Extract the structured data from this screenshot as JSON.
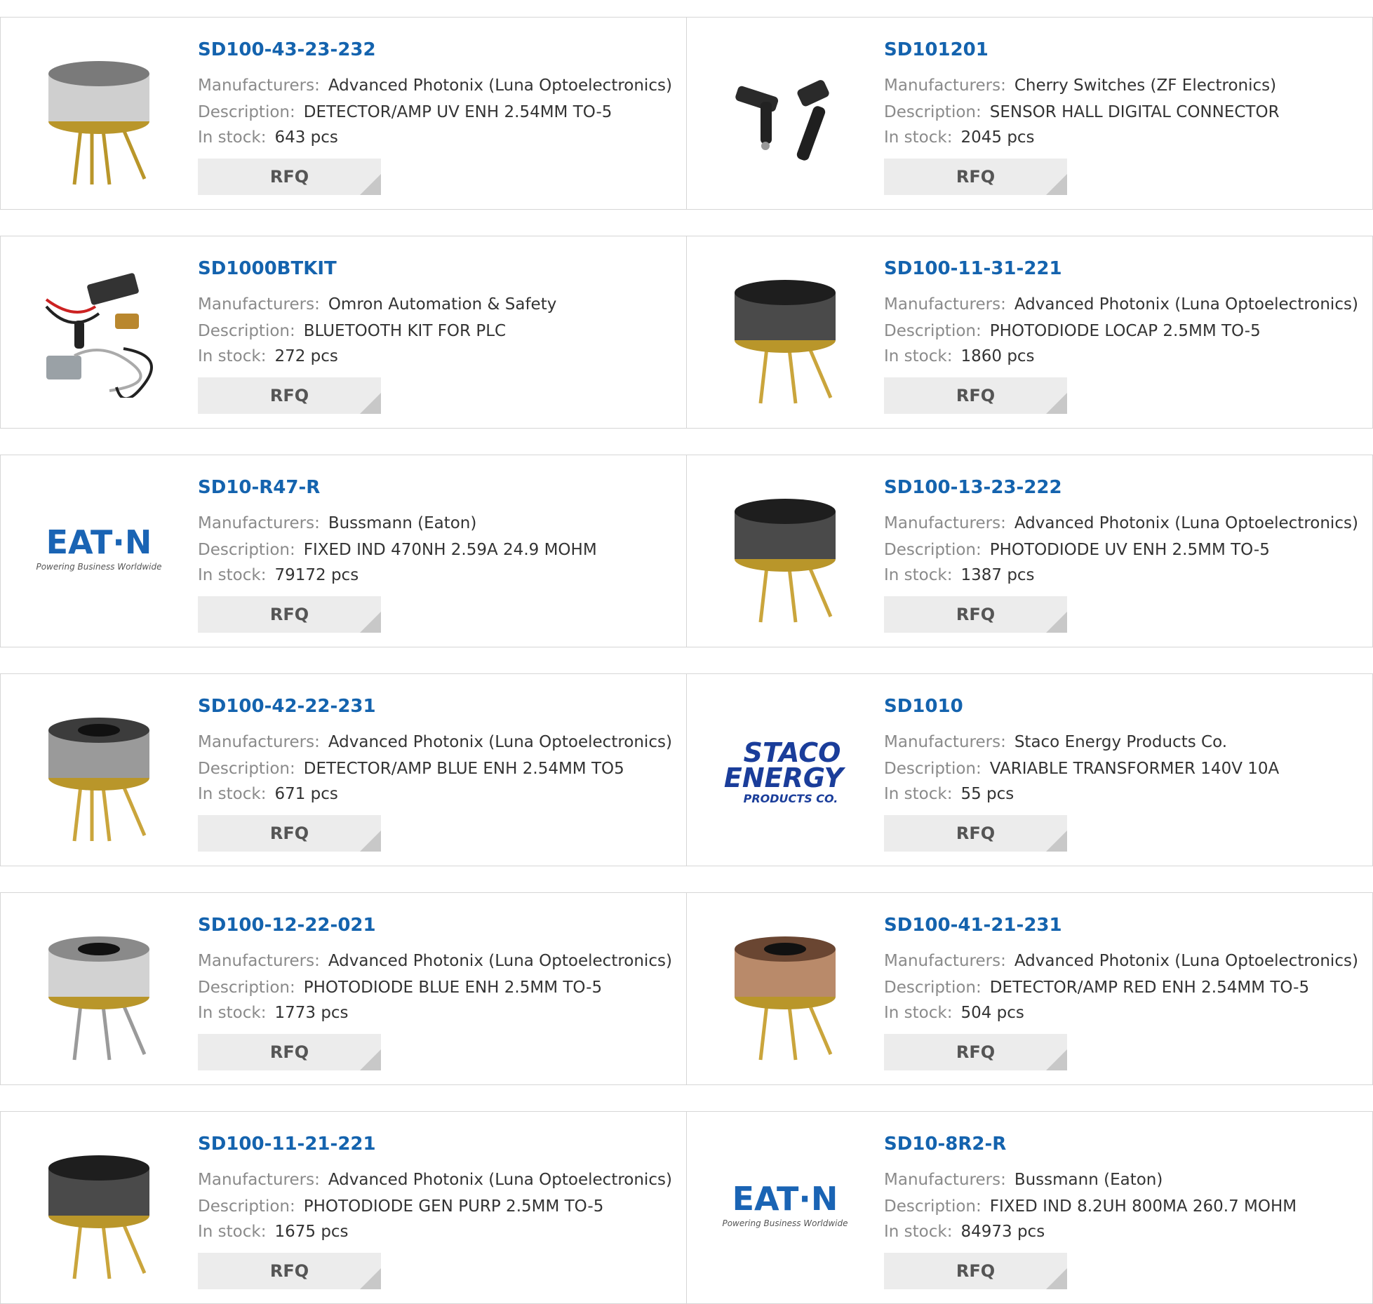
{
  "labels": {
    "manufacturers": "Manufacturers:",
    "description": "Description:",
    "in_stock": "In stock:",
    "rfq": "RFQ"
  },
  "colors": {
    "title": "#1463ae",
    "label": "#8a8a8a",
    "rfq_bg": "#ececec",
    "eaton_blue": "#1a64b4",
    "staco_blue": "#1a3d9a"
  },
  "products": [
    {
      "part": "SD100-43-23-232",
      "manufacturer": "Advanced Photonix (Luna Optoelectronics)",
      "description": "DETECTOR/AMP UV ENH 2.54MM TO-5",
      "stock": "643 pcs",
      "image": "to5-silver-can"
    },
    {
      "part": "SD101201",
      "manufacturer": "Cherry Switches (ZF Electronics)",
      "description": "SENSOR HALL DIGITAL CONNECTOR",
      "stock": "2045 pcs",
      "image": "hall-sensors"
    },
    {
      "part": "SD1000BTKIT",
      "manufacturer": "Omron Automation & Safety",
      "description": "BLUETOOTH KIT FOR PLC",
      "stock": "272 pcs",
      "image": "bluetooth-kit"
    },
    {
      "part": "SD100-11-31-221",
      "manufacturer": "Advanced Photonix (Luna Optoelectronics)",
      "description": "PHOTODIODE LOCAP 2.5MM TO-5",
      "stock": "1860 pcs",
      "image": "to5-dark-can"
    },
    {
      "part": "SD10-R47-R",
      "manufacturer": "Bussmann (Eaton)",
      "description": "FIXED IND 470NH 2.59A 24.9 MOHM",
      "stock": "79172 pcs",
      "image": "eaton-logo"
    },
    {
      "part": "SD100-13-23-222",
      "manufacturer": "Advanced Photonix (Luna Optoelectronics)",
      "description": "PHOTODIODE UV ENH 2.5MM TO-5",
      "stock": "1387 pcs",
      "image": "to5-dark-can"
    },
    {
      "part": "SD100-42-22-231",
      "manufacturer": "Advanced Photonix (Luna Optoelectronics)",
      "description": "DETECTOR/AMP BLUE ENH 2.54MM TO5",
      "stock": "671 pcs",
      "image": "to5-window-can"
    },
    {
      "part": "SD1010",
      "manufacturer": "Staco Energy Products Co.",
      "description": "VARIABLE TRANSFORMER 140V 10A",
      "stock": "55 pcs",
      "image": "staco-logo"
    },
    {
      "part": "SD100-12-22-021",
      "manufacturer": "Advanced Photonix (Luna Optoelectronics)",
      "description": "PHOTODIODE BLUE ENH 2.5MM TO-5",
      "stock": "1773 pcs",
      "image": "to5-silver-window"
    },
    {
      "part": "SD100-41-21-231",
      "manufacturer": "Advanced Photonix (Luna Optoelectronics)",
      "description": "DETECTOR/AMP RED ENH 2.54MM TO-5",
      "stock": "504 pcs",
      "image": "to5-copper-can"
    },
    {
      "part": "SD100-11-21-221",
      "manufacturer": "Advanced Photonix (Luna Optoelectronics)",
      "description": "PHOTODIODE GEN PURP 2.5MM TO-5",
      "stock": "1675 pcs",
      "image": "to5-dark-can"
    },
    {
      "part": "SD10-8R2-R",
      "manufacturer": "Bussmann (Eaton)",
      "description": "FIXED IND 8.2UH 800MA 260.7 MOHM",
      "stock": "84973 pcs",
      "image": "eaton-logo"
    }
  ],
  "logos": {
    "eaton": {
      "word": "EAT·N",
      "tagline": "Powering Business Worldwide"
    },
    "staco": {
      "line1": "STACO",
      "line2": "ENERGY",
      "line3": "PRODUCTS CO."
    }
  }
}
